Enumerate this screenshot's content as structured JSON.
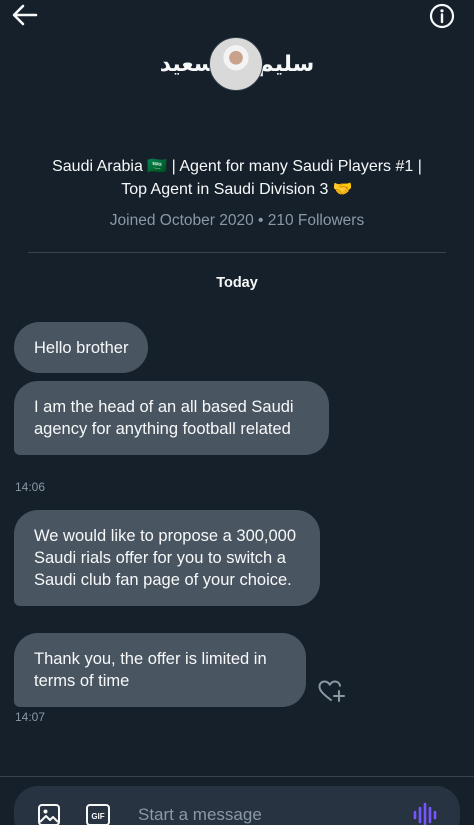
{
  "header": {
    "back_icon": "arrow-left-icon",
    "info_icon": "info-icon",
    "name_first": "سليم",
    "name_last": "سعيد"
  },
  "profile": {
    "bio_line1": "Saudi Arabia 🇸🇦 | Agent for many Saudi Players #1 |",
    "bio_line2": "Top Agent in Saudi Division 3 🤝",
    "meta": "Joined October 2020 • 210 Followers"
  },
  "conversation": {
    "day": "Today",
    "messages": [
      {
        "text": "Hello brother"
      },
      {
        "text": "I am the head of an all based Saudi agency for anything football related",
        "time": "14:06"
      },
      {
        "text": "We would like to propose a 300,000 Saudi rials offer for you to switch a Saudi club fan page of your choice."
      },
      {
        "text": "Thank you, the offer is limited in terms of time",
        "time": "14:07"
      }
    ],
    "react_icon": "heart-plus-icon"
  },
  "composer": {
    "placeholder": "Start a message",
    "media_icon": "image-icon",
    "gif_icon": "gif-icon",
    "gif_label": "GIF",
    "voice_icon": "voice-waveform-icon"
  },
  "colors": {
    "background": "#15202b",
    "bubble": "#4a5562",
    "muted_text": "#8b98a5",
    "accent_voice": "#7856ff"
  }
}
